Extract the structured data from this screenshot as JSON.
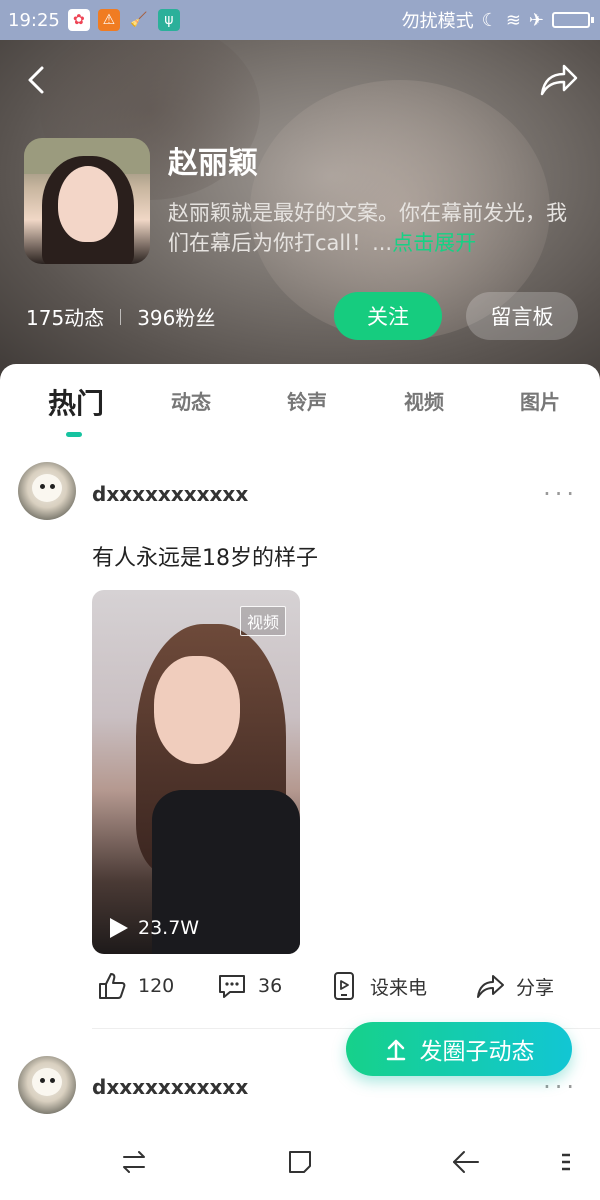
{
  "status_bar": {
    "time": "19:25",
    "dnd_label": "勿扰模式"
  },
  "profile": {
    "name": "赵丽颖",
    "desc_text": "赵丽颖就是最好的文案。你在幕前发光，我们在幕后为你打call！...",
    "desc_more": "点击展开",
    "posts_count": "175动态",
    "fans_count": "396粉丝",
    "follow_label": "关注",
    "guestbook_label": "留言板"
  },
  "tabs": [
    "热门",
    "动态",
    "铃声",
    "视频",
    "图片"
  ],
  "posts": [
    {
      "username": "dxxxxxxxxxxx",
      "text": "有人永远是18岁的样子",
      "video_badge": "视频",
      "play_count": "23.7W",
      "like_count": "120",
      "comment_count": "36",
      "ringtone_label": "设来电",
      "share_label": "分享"
    },
    {
      "username": "dxxxxxxxxxxx"
    }
  ],
  "fab_label": "发圈子动态",
  "colors": {
    "accent": "#16cc7f",
    "link": "#17d184",
    "tab_indicator": "#16c3a0"
  }
}
